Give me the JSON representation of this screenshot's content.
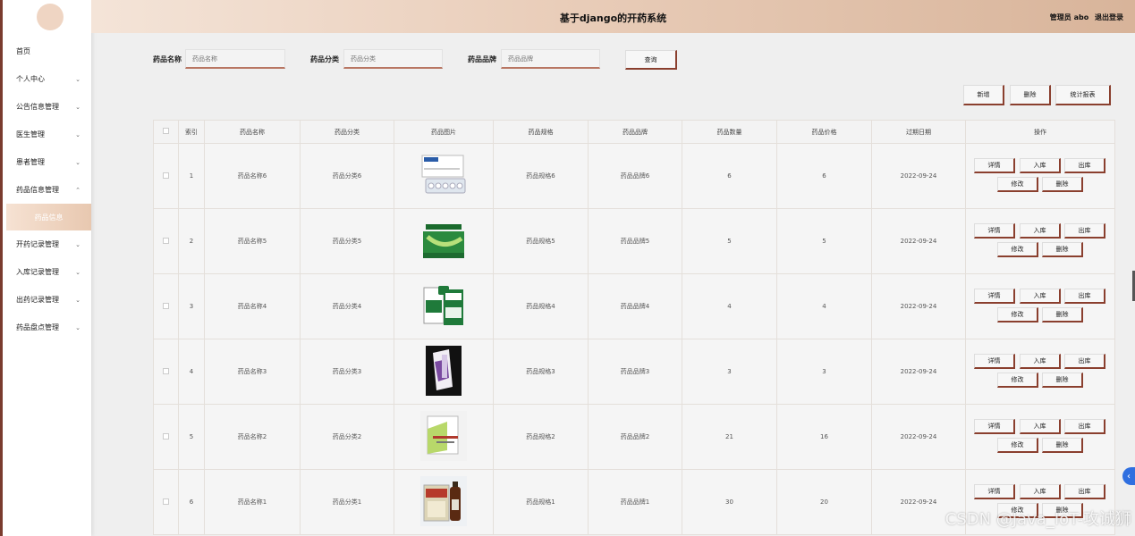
{
  "header": {
    "title": "基于django的开药系统",
    "user_label": "管理员 abo",
    "logout": "退出登录"
  },
  "sidebar": {
    "items": [
      {
        "label": "首页",
        "chevron": ""
      },
      {
        "label": "个人中心",
        "chevron": "v"
      },
      {
        "label": "公告信息管理",
        "chevron": "v"
      },
      {
        "label": "医生管理",
        "chevron": "v"
      },
      {
        "label": "患者管理",
        "chevron": "v"
      },
      {
        "label": "药品信息管理",
        "chevron": "^"
      },
      {
        "label": "开药记录管理",
        "chevron": "v"
      },
      {
        "label": "入库记录管理",
        "chevron": "v"
      },
      {
        "label": "出药记录管理",
        "chevron": "v"
      },
      {
        "label": "药品盘点管理",
        "chevron": "v"
      }
    ],
    "active_sub": "药品信息"
  },
  "search": {
    "name_label": "药品名称",
    "name_placeholder": "药品名称",
    "category_label": "药品分类",
    "category_placeholder": "药品分类",
    "brand_label": "药品品牌",
    "brand_placeholder": "药品品牌",
    "query_button": "查询"
  },
  "actions": {
    "add": "新增",
    "delete": "删除",
    "report": "统计报表"
  },
  "table": {
    "headers": [
      "",
      "索引",
      "药品名称",
      "药品分类",
      "药品图片",
      "药品规格",
      "药品品牌",
      "药品数量",
      "药品价格",
      "过期日期",
      "操作"
    ],
    "rows": [
      {
        "index": "1",
        "name": "药品名称6",
        "category": "药品分类6",
        "spec": "药品规格6",
        "brand": "药品品牌6",
        "qty": "6",
        "price": "6",
        "expire": "2022-09-24"
      },
      {
        "index": "2",
        "name": "药品名称5",
        "category": "药品分类5",
        "spec": "药品规格5",
        "brand": "药品品牌5",
        "qty": "5",
        "price": "5",
        "expire": "2022-09-24"
      },
      {
        "index": "3",
        "name": "药品名称4",
        "category": "药品分类4",
        "spec": "药品规格4",
        "brand": "药品品牌4",
        "qty": "4",
        "price": "4",
        "expire": "2022-09-24"
      },
      {
        "index": "4",
        "name": "药品名称3",
        "category": "药品分类3",
        "spec": "药品规格3",
        "brand": "药品品牌3",
        "qty": "3",
        "price": "3",
        "expire": "2022-09-24"
      },
      {
        "index": "5",
        "name": "药品名称2",
        "category": "药品分类2",
        "spec": "药品规格2",
        "brand": "药品品牌2",
        "qty": "21",
        "price": "16",
        "expire": "2022-09-24"
      },
      {
        "index": "6",
        "name": "药品名称1",
        "category": "药品分类1",
        "spec": "药品规格1",
        "brand": "药品品牌1",
        "qty": "30",
        "price": "20",
        "expire": "2022-09-24"
      }
    ],
    "op_labels": {
      "detail": "详情",
      "stock_in": "入库",
      "stock_out": "出库",
      "edit": "修改",
      "delete": "删除"
    }
  },
  "watermark": "CSDN @Java_IoT-攻诚狮",
  "colors": {
    "accent": "#8a3f2e",
    "header_start": "#f4e4d8",
    "header_end": "#d8b49a"
  }
}
